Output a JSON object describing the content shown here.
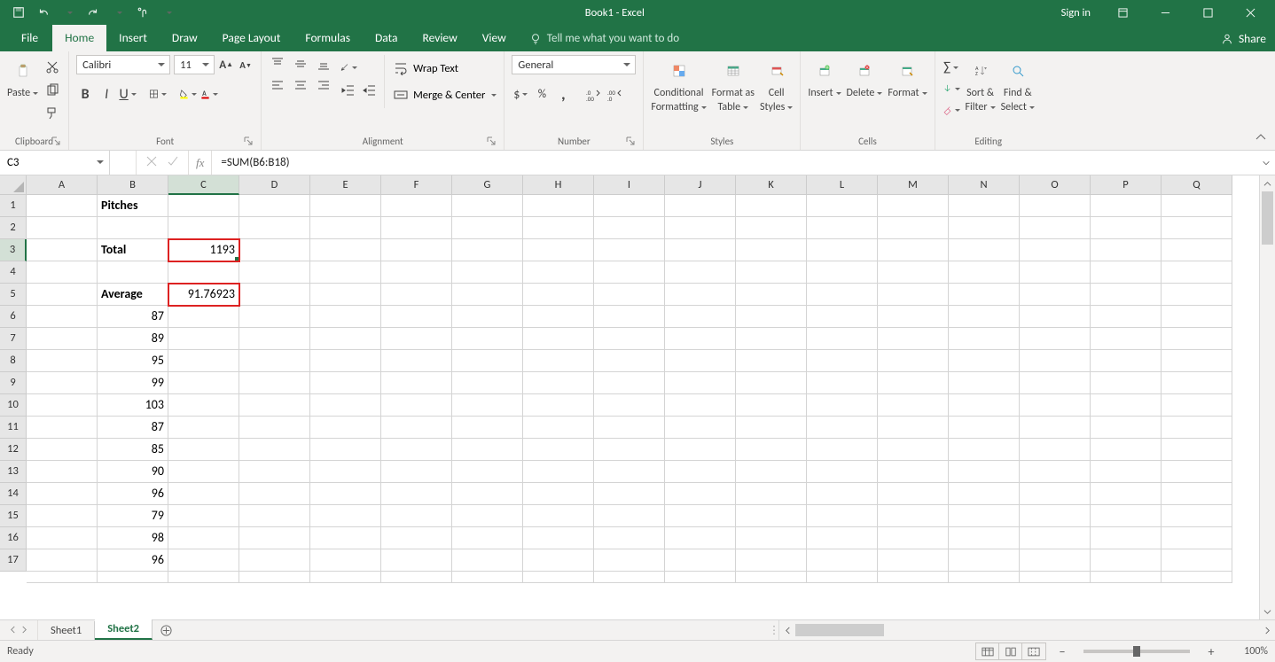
{
  "titlebar": {
    "title": "Book1 - Excel",
    "signin": "Sign in"
  },
  "tabs": {
    "file": "File",
    "home": "Home",
    "insert": "Insert",
    "draw": "Draw",
    "page_layout": "Page Layout",
    "formulas": "Formulas",
    "data": "Data",
    "review": "Review",
    "view": "View",
    "tellme": "Tell me what you want to do",
    "share": "Share"
  },
  "ribbon": {
    "clipboard": {
      "label": "Clipboard",
      "paste": "Paste"
    },
    "font": {
      "label": "Font",
      "name": "Calibri",
      "size": "11"
    },
    "alignment": {
      "label": "Alignment",
      "wrap": "Wrap Text",
      "merge": "Merge & Center"
    },
    "number": {
      "label": "Number",
      "format": "General"
    },
    "styles": {
      "label": "Styles",
      "cond": "Conditional",
      "cond2": "Formatting",
      "fat": "Format as",
      "fat2": "Table",
      "cell": "Cell",
      "cell2": "Styles"
    },
    "cells": {
      "label": "Cells",
      "insert": "Insert",
      "delete": "Delete",
      "format": "Format"
    },
    "editing": {
      "label": "Editing",
      "sort": "Sort &",
      "sort2": "Filter",
      "find": "Find &",
      "find2": "Select"
    }
  },
  "formula_bar": {
    "name_box": "C3",
    "fx": "fx",
    "formula": "=SUM(B6:B18)"
  },
  "columns": [
    "A",
    "B",
    "C",
    "D",
    "E",
    "F",
    "G",
    "H",
    "I",
    "J",
    "K",
    "L",
    "M",
    "N",
    "O",
    "P",
    "Q"
  ],
  "active_col_index": 2,
  "row_count": 17,
  "active_row_index": 2,
  "cells": {
    "B1": {
      "v": "Pitches",
      "bold": true
    },
    "B3": {
      "v": "Total",
      "bold": true
    },
    "C3": {
      "v": "1193",
      "num": true
    },
    "B5": {
      "v": "Average",
      "bold": true
    },
    "C5": {
      "v": "91.76923",
      "num": true
    },
    "B6": {
      "v": "87",
      "num": true
    },
    "B7": {
      "v": "89",
      "num": true
    },
    "B8": {
      "v": "95",
      "num": true
    },
    "B9": {
      "v": "99",
      "num": true
    },
    "B10": {
      "v": "103",
      "num": true
    },
    "B11": {
      "v": "87",
      "num": true
    },
    "B12": {
      "v": "85",
      "num": true
    },
    "B13": {
      "v": "90",
      "num": true
    },
    "B14": {
      "v": "96",
      "num": true
    },
    "B15": {
      "v": "79",
      "num": true
    },
    "B16": {
      "v": "98",
      "num": true
    },
    "B17": {
      "v": "96",
      "num": true
    }
  },
  "red_boxes": [
    {
      "col": 2,
      "row": 2
    },
    {
      "col": 2,
      "row": 4
    }
  ],
  "selection": {
    "col": 2,
    "row": 2
  },
  "sheets": {
    "s1": "Sheet1",
    "s2": "Sheet2"
  },
  "status": {
    "ready": "Ready",
    "zoom": "100%"
  }
}
